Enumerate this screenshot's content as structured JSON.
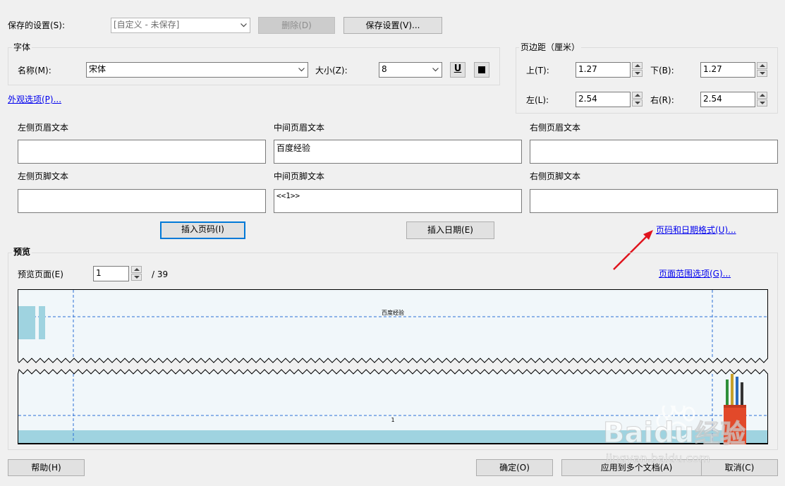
{
  "saved_settings": {
    "label": "保存的设置(S):",
    "value": "[自定义 - 未保存]",
    "delete_label": "删除(D)",
    "save_label": "保存设置(V)..."
  },
  "font": {
    "group_title": "字体",
    "name_label": "名称(M):",
    "name_value": "宋体",
    "size_label": "大小(Z):",
    "size_value": "8",
    "underline_glyph": "U"
  },
  "appearance_link": "外观选项(P)...",
  "margins": {
    "group_title": "页边距（厘米）",
    "top_label": "上(T):",
    "top_value": "1.27",
    "bottom_label": "下(B):",
    "bottom_value": "1.27",
    "left_label": "左(L):",
    "left_value": "2.54",
    "right_label": "右(R):",
    "right_value": "2.54"
  },
  "header": {
    "left_label": "左侧页眉文本",
    "center_label": "中间页眉文本",
    "right_label": "右侧页眉文本",
    "left_value": "",
    "center_value": "百度经验",
    "right_value": ""
  },
  "footer": {
    "left_label": "左侧页脚文本",
    "center_label": "中间页脚文本",
    "right_label": "右侧页脚文本",
    "left_value": "",
    "center_value": "<<1>>",
    "right_value": ""
  },
  "insert_page_label": "插入页码(I)",
  "insert_date_label": "插入日期(E)",
  "page_date_format_link": "页码和日期格式(U)...",
  "preview": {
    "group_title": "预览",
    "page_label": "预览页面(E)",
    "page_value": "1",
    "page_total": "/ 39",
    "page_range_link": "页面范围选项(G)...",
    "header_text": "百度经验",
    "footer_text": "1"
  },
  "buttons": {
    "help": "帮助(H)",
    "ok": "确定(O)",
    "apply_multi": "应用到多个文档(A)",
    "cancel": "取消(C)"
  },
  "colors": {
    "accent": "#0078d7",
    "link": "#0000ee",
    "preview_bg": "#f1f7fa",
    "preview_guide": "#2a6fd6",
    "preview_band": "#9fd3e0",
    "arrow": "#e0141e"
  },
  "watermark": "Baidu经验 jingyan.baidu.com"
}
